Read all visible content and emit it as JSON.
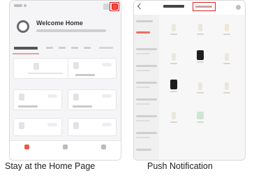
{
  "captions": {
    "home": "Stay at the Home Page",
    "push": "Push Notification"
  },
  "home_screen": {
    "title": "Welcome Home"
  },
  "colors": {
    "accent": "#ea5a4c",
    "highlight_box": "#e02020"
  },
  "icons": {
    "home_add": "plus-icon",
    "home_message": "message-icon",
    "push_back": "back-arrow-icon",
    "push_settings": "gear-icon"
  }
}
